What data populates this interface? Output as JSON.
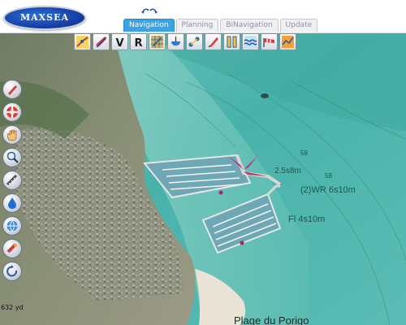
{
  "app": {
    "logo_text": "MAXSEA"
  },
  "tabs": [
    {
      "label": "Navigation",
      "active": true
    },
    {
      "label": "Planning",
      "active": false
    },
    {
      "label": "BiNavigation",
      "active": false
    },
    {
      "label": "Update",
      "active": false
    }
  ],
  "top_toolbar": [
    {
      "icon": "route-icon"
    },
    {
      "icon": "red-ship-icon"
    },
    {
      "icon": "v-letter-icon",
      "text": "V"
    },
    {
      "icon": "r-letter-icon",
      "text": "R"
    },
    {
      "icon": "chart-grid-icon"
    },
    {
      "icon": "tide-gauge-icon"
    },
    {
      "icon": "waypoints-icon"
    },
    {
      "icon": "red-pen-icon"
    },
    {
      "icon": "yellow-bars-icon"
    },
    {
      "icon": "wave-icon"
    },
    {
      "icon": "windsock-icon"
    },
    {
      "icon": "orange-chart-icon"
    }
  ],
  "side_toolbar": [
    {
      "icon": "pencil-icon"
    },
    {
      "icon": "lifebuoy-icon"
    },
    {
      "icon": "hand-pan-icon"
    },
    {
      "icon": "magnifier-icon"
    },
    {
      "icon": "ruler-icon"
    },
    {
      "icon": "waterdrop-icon"
    },
    {
      "icon": "globe-icon"
    },
    {
      "icon": "satellite-icon"
    },
    {
      "icon": "rotate-icon"
    }
  ],
  "map": {
    "scale_text": "632 yd",
    "labels": {
      "place": "Plage du Porigo",
      "light": "(2)WR 6s10m",
      "light2": "Fl 4s10m",
      "light3": "2.5s8m",
      "depth1": "58",
      "depth2": "58"
    }
  }
}
